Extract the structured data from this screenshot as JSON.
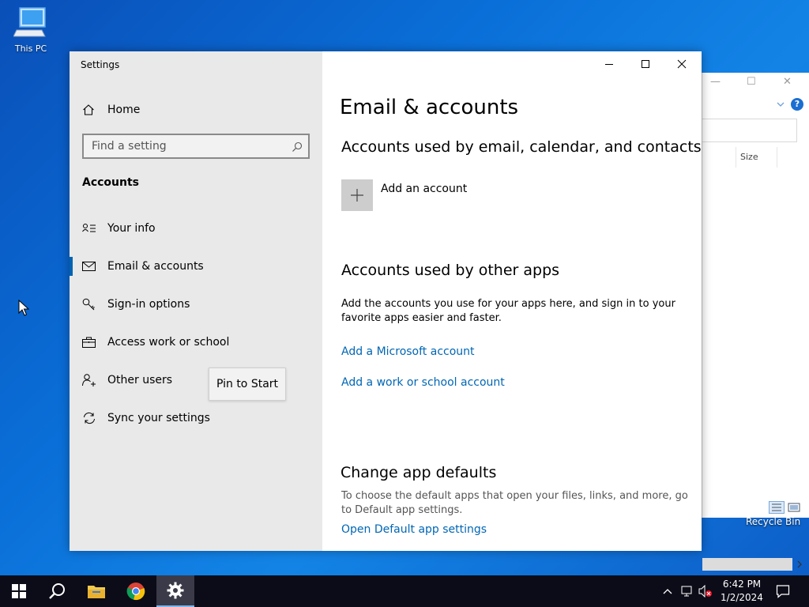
{
  "desktop": {
    "icons": [
      {
        "label": "This PC"
      },
      {
        "label": "Recycle Bin"
      }
    ]
  },
  "explorer": {
    "column_size": "Size",
    "help": "?"
  },
  "settings": {
    "window_title": "Settings",
    "home_label": "Home",
    "search_placeholder": "Find a setting",
    "section_title": "Accounts",
    "nav": [
      {
        "label": "Your info",
        "icon": "person-card-icon"
      },
      {
        "label": "Email & accounts",
        "icon": "mail-icon",
        "active": true
      },
      {
        "label": "Sign-in options",
        "icon": "key-icon"
      },
      {
        "label": "Access work or school",
        "icon": "briefcase-icon"
      },
      {
        "label": "Other users",
        "icon": "person-add-icon"
      },
      {
        "label": "Sync your settings",
        "icon": "sync-icon"
      }
    ],
    "context_tooltip": "Pin to Start",
    "page_title": "Email & accounts",
    "section_email": "Accounts used by email, calendar, and contacts",
    "add_account": "Add an account",
    "section_other": "Accounts used by other apps",
    "other_desc": "Add the accounts you use for your apps here, and sign in to your favorite apps easier and faster.",
    "link_microsoft": "Add a Microsoft account",
    "link_work": "Add a work or school account",
    "section_defaults": "Change app defaults",
    "defaults_desc": "To choose the default apps that open your files, links, and more, go to Default app settings.",
    "link_defaults": "Open Default app settings"
  },
  "taskbar": {
    "time": "6:42 PM",
    "date": "1/2/2024",
    "accent_color": "#7fb4ee"
  }
}
